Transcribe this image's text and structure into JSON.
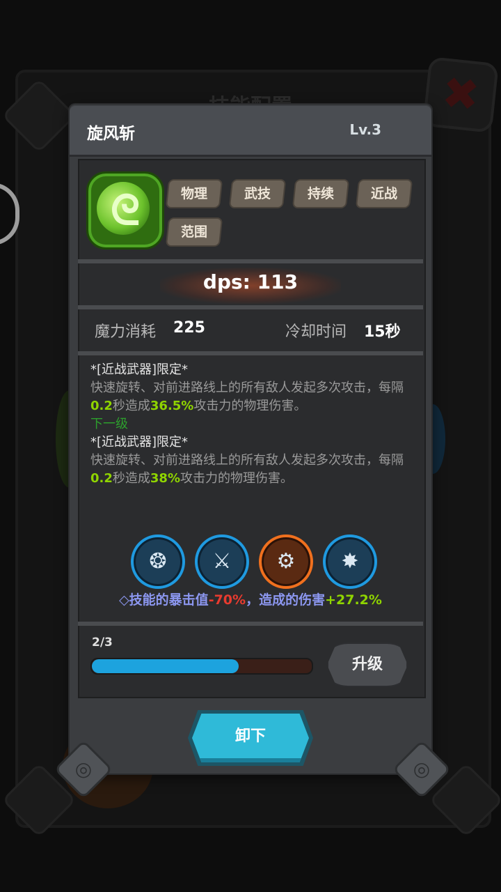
{
  "background": {
    "title": "技能配置",
    "close_icon": "✖"
  },
  "skill": {
    "name": "旋风斩",
    "level": "Lv.3",
    "icon": "whirlwind-icon",
    "tags": [
      "物理",
      "武技",
      "持续",
      "近战",
      "范围"
    ],
    "dps": "dps: 113",
    "mana_label": "魔力消耗",
    "mana_value": "225",
    "cooldown_label": "冷却时间",
    "cooldown_value": "15秒"
  },
  "description": {
    "current": {
      "limit": "*[近战武器]限定*",
      "text_a": "快速旋转、对前进路线上的所有敌人发起多次攻击，每隔",
      "interval": "0.2",
      "text_b": "秒造成",
      "percent": "36.5%",
      "text_c": "攻击力的物理伤害。"
    },
    "next_label": "下一级",
    "next": {
      "limit": "*[近战武器]限定*",
      "text_a": "快速旋转、对前进路线上的所有敌人发起多次攻击，每隔",
      "interval": "0.2",
      "text_b": "秒造成",
      "percent": "38%",
      "text_c": "攻击力的物理伤害。"
    }
  },
  "talents": [
    {
      "icon": "burst-crater-icon",
      "color": "#1f9ae0"
    },
    {
      "icon": "slash-swirl-icon",
      "color": "#1f9ae0"
    },
    {
      "icon": "sword-cog-icon",
      "color": "#f0701e"
    },
    {
      "icon": "ground-impact-icon",
      "color": "#1f9ae0"
    }
  ],
  "bonus": {
    "prefix": "◇技能的暴击值",
    "crit": "-70%",
    "middle": "，造成的伤害",
    "damage": "+27.2%"
  },
  "progress": {
    "label": "2/3",
    "fraction": 0.667
  },
  "buttons": {
    "upgrade": "升级",
    "unload": "卸下"
  }
}
